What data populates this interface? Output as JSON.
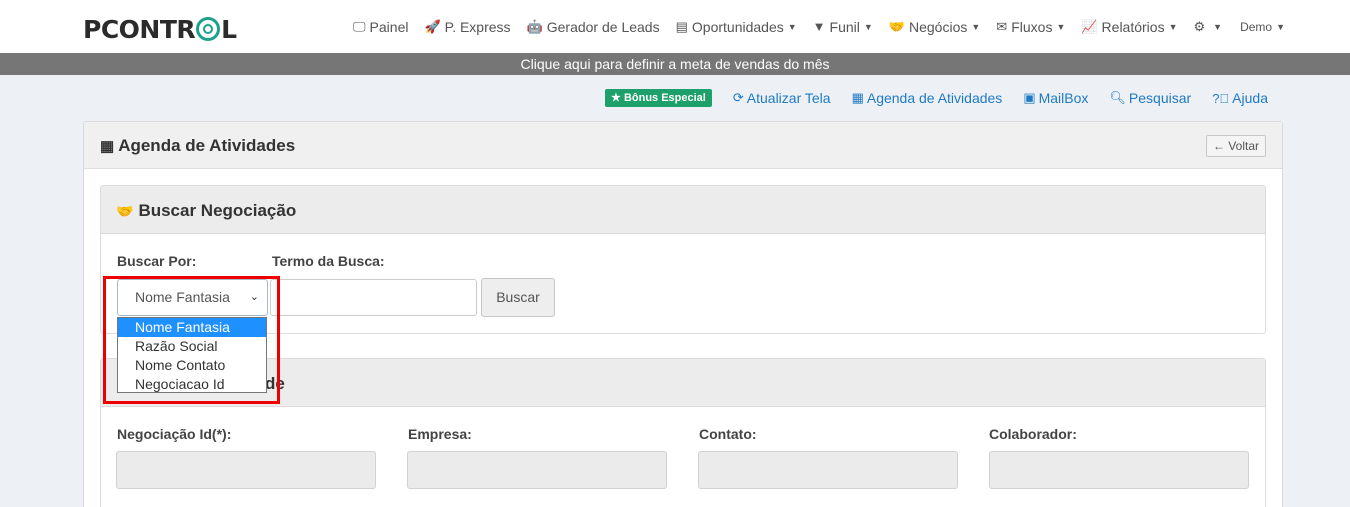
{
  "brand": {
    "logo_text_a": "PCONTR",
    "logo_text_b": "L"
  },
  "nav": {
    "items": [
      {
        "icon": "monitor-icon",
        "glyph": "🖵",
        "label": "Painel",
        "caret": false
      },
      {
        "icon": "rocket-icon",
        "glyph": "🚀",
        "label": "P. Express",
        "caret": false
      },
      {
        "icon": "robot-icon",
        "glyph": "🤖",
        "label": "Gerador de Leads",
        "caret": false
      },
      {
        "icon": "clipboard-icon",
        "glyph": "▤",
        "label": "Oportunidades",
        "caret": true
      },
      {
        "icon": "filter-icon",
        "glyph": "▼",
        "label": "Funil",
        "caret": true
      },
      {
        "icon": "handshake-icon",
        "glyph": "🤝",
        "label": "Negócios",
        "caret": true
      },
      {
        "icon": "envelope-icon",
        "glyph": "✉",
        "label": "Fluxos",
        "caret": true
      },
      {
        "icon": "chart-line-icon",
        "glyph": "📈",
        "label": "Relatórios",
        "caret": true
      }
    ],
    "settings_glyph": "⚙",
    "user_label": "Demo"
  },
  "goal_banner": "Clique aqui para definir a meta de vendas do mês",
  "toolbar": {
    "bonus": "Bônus Especial",
    "refresh": "Atualizar Tela",
    "agenda": "Agenda de Atividades",
    "mailbox": "MailBox",
    "search": "Pesquisar",
    "help": "Ajuda"
  },
  "page": {
    "title": "Agenda de Atividades",
    "back_label": "← Voltar"
  },
  "search_panel": {
    "title": "Buscar Negociação",
    "search_by_label": "Buscar Por:",
    "term_label": "Termo da Busca:",
    "selected": "Nome Fantasia",
    "options": [
      "Nome Fantasia",
      "Razão Social",
      "Nome Contato",
      "Negociacao Id"
    ],
    "term_value": "",
    "button_label": "Buscar"
  },
  "deal_panel": {
    "title_visible": "de",
    "fields": [
      {
        "label": "Negociação Id(*):"
      },
      {
        "label": "Empresa:"
      },
      {
        "label": "Contato:"
      },
      {
        "label": "Colaborador:"
      }
    ]
  },
  "colors": {
    "accent": "#1f7ac4",
    "brand_green": "#1ea08a",
    "bonus": "#1ea06a",
    "highlight": "#e00000"
  }
}
